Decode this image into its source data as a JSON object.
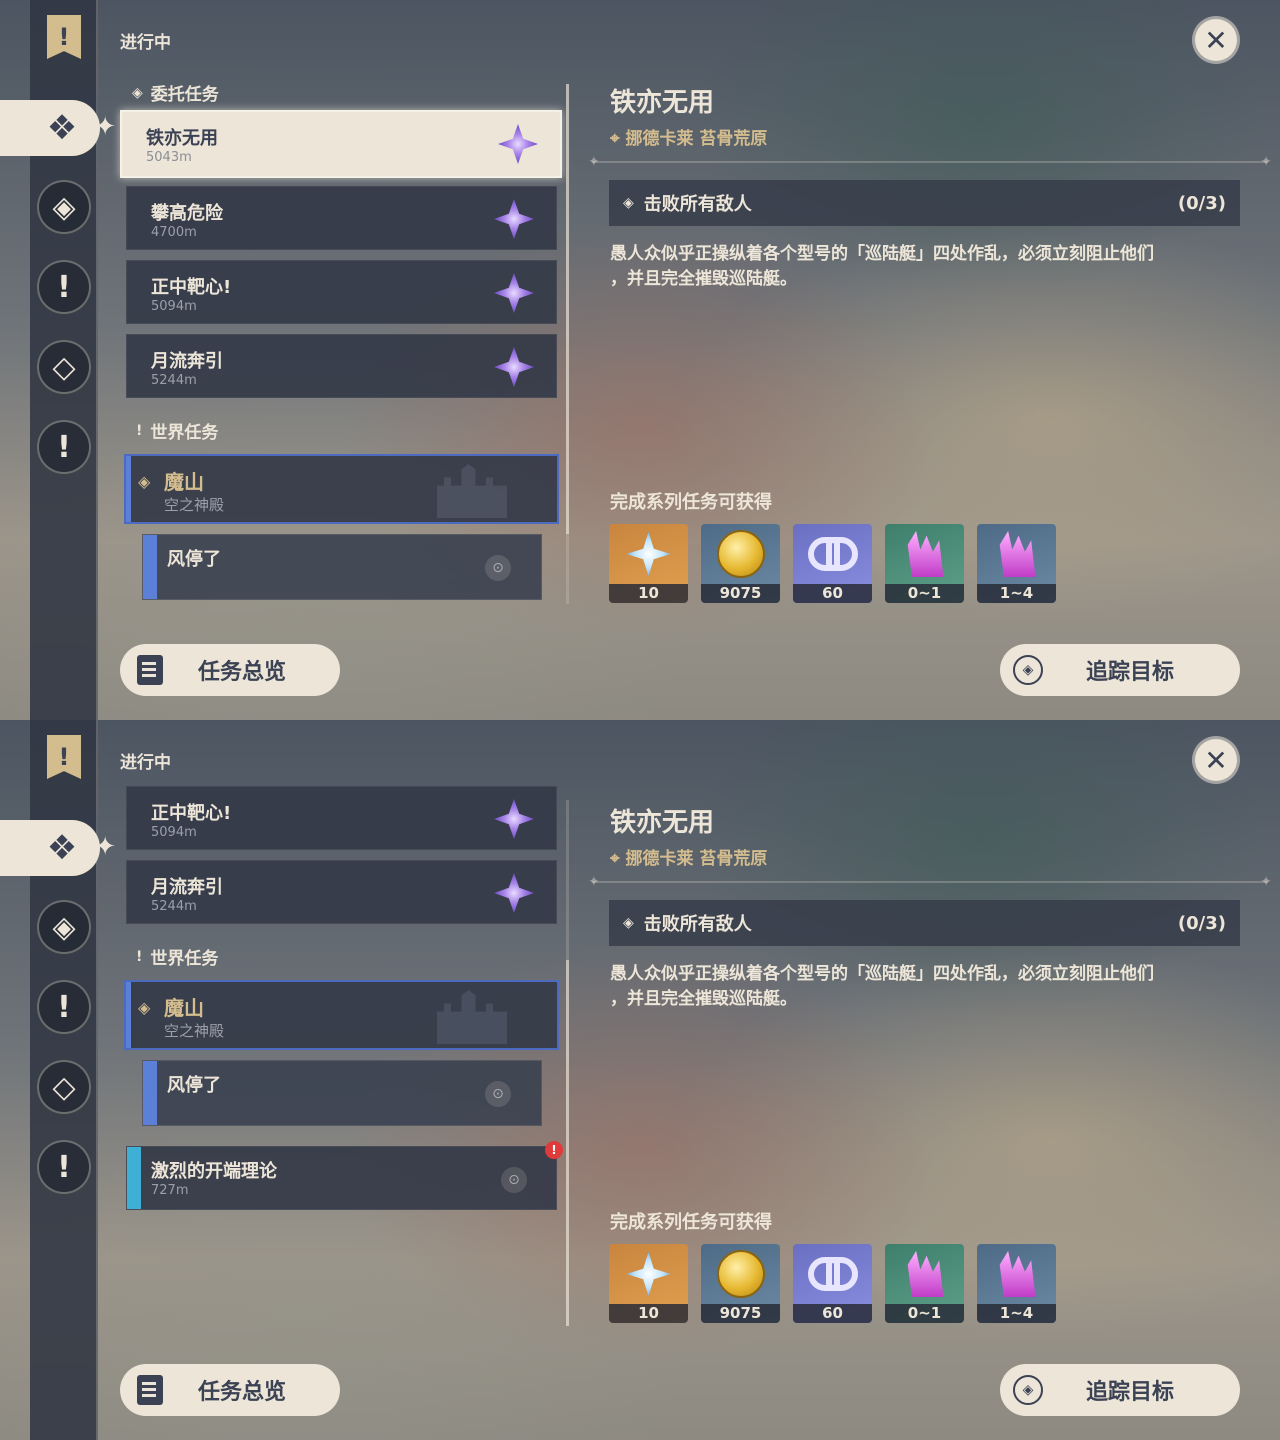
{
  "common": {
    "section_in_progress": "进行中",
    "category_commission": "委托任务",
    "category_world": "世界任务",
    "overview_button": "任务总览",
    "track_button": "追踪目标",
    "close_icon": "close-icon",
    "detail": {
      "title": "铁亦无用",
      "location": "挪德卡莱 苔骨荒原",
      "objective": "击败所有敌人",
      "objective_count": "(0/3)",
      "description_line1": "愚人众似乎正操纵着各个型号的「巡陆艇」四处作乱，必须立刻阻止他们",
      "description_line2": "，并且完全摧毁巡陆艇。",
      "rewards_label": "完成系列任务可获得",
      "rewards": [
        {
          "icon": "primogem-icon",
          "qty": "10"
        },
        {
          "icon": "mora-icon",
          "qty": "9075"
        },
        {
          "icon": "adventure-exp-icon",
          "qty": "60"
        },
        {
          "icon": "crystal-chunk-icon",
          "qty": "0~1"
        },
        {
          "icon": "crystal-cluster-icon",
          "qty": "1~4"
        }
      ]
    }
  },
  "panel1": {
    "commissions": [
      {
        "title": "铁亦无用",
        "distance": "5043m",
        "selected": true
      },
      {
        "title": "攀高危险",
        "distance": "4700m"
      },
      {
        "title": "正中靶心!",
        "distance": "5094m"
      },
      {
        "title": "月流奔引",
        "distance": "5244m"
      }
    ],
    "world_quest": {
      "title": "魔山",
      "subtitle": "空之神殿"
    },
    "sub_quest": {
      "title": "风停了"
    }
  },
  "panel2": {
    "commissions": [
      {
        "title": "正中靶心!",
        "distance": "5094m"
      },
      {
        "title": "月流奔引",
        "distance": "5244m"
      }
    ],
    "world_quest": {
      "title": "魔山",
      "subtitle": "空之神殿"
    },
    "sub_quest": {
      "title": "风停了"
    },
    "event_quest": {
      "title": "激烈的开端理论",
      "distance": "727m",
      "alert": "!"
    }
  }
}
